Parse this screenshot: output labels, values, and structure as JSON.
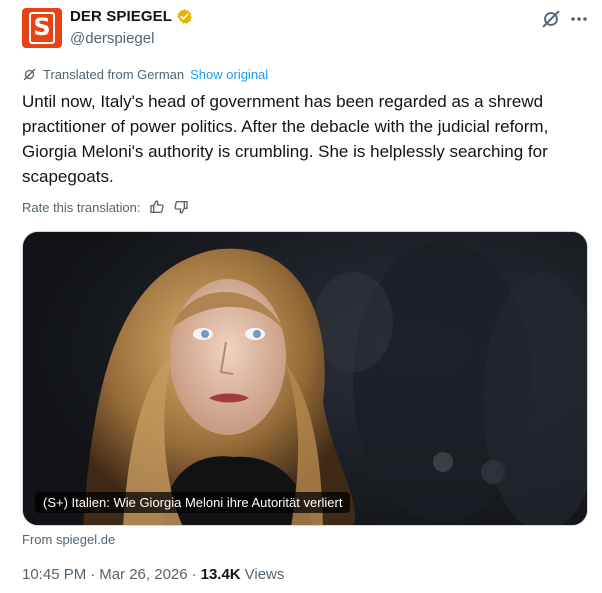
{
  "author": {
    "display_name": "DER SPIEGEL",
    "handle": "@derspiegel",
    "avatar_letter": "S",
    "avatar_color": "#e64415",
    "verified_color": "#e8b400"
  },
  "translation": {
    "label": "Translated from German",
    "show_original": "Show original"
  },
  "tweet": {
    "text": "Until now, Italy's head of government has been regarded as a shrewd practitioner of power politics. After the debacle with the judicial reform, Giorgia Meloni's authority is crumbling. She is helplessly searching for scapegoats."
  },
  "rate": {
    "label": "Rate this translation:"
  },
  "card": {
    "caption": "(S+) Italien: Wie Giorgia Meloni ihre Autorität verliert",
    "source": "From spiegel.de"
  },
  "meta": {
    "time": "10:45 PM",
    "separator": "·",
    "date": "Mar 26, 2026",
    "views_count": "13.4K",
    "views_label": "Views"
  },
  "icons": {
    "grok": "grok-icon",
    "more": "more-options-icon",
    "translate": "translate-icon",
    "thumbs_up": "thumbs-up-icon",
    "thumbs_down": "thumbs-down-icon"
  }
}
